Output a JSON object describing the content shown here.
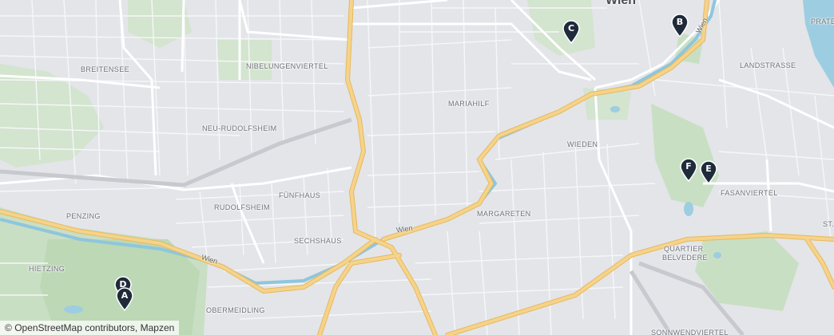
{
  "map": {
    "labels": {
      "wien_city": "Wien",
      "breitensee": "BREITENSEE",
      "nibelungenviertel": "NIBELUNGENVIERTEL",
      "mariahilf": "MARIAHILF",
      "landstrasse": "LANDSTRASSE",
      "praterc": "PRATERC",
      "neu_rudolfsheim": "NEU-RUDOLFSHEIM",
      "wieden": "WIEDEN",
      "fasanviertel": "FASANVIERTEL",
      "fuenfhaus": "FÜNFHAUS",
      "rudolfsheim": "RUDOLFSHEIM",
      "penzing": "PENZING",
      "margareten": "MARGARETEN",
      "sechshaus": "SECHSHAUS",
      "st": "ST.",
      "quartier_belvedere_1": "QUARTIER",
      "quartier_belvedere_2": "BELVEDERE",
      "hietzing": "HIETZING",
      "obermeidling": "OBERMEIDLING",
      "sonnwendviertel": "SONNWENDVIERTEL"
    },
    "road_labels": {
      "wien_river_1": "Wien",
      "wien_river_2": "Wien",
      "wien_river_3": "Wien"
    },
    "markers": [
      {
        "letter": "A"
      },
      {
        "letter": "B"
      },
      {
        "letter": "C"
      },
      {
        "letter": "D"
      },
      {
        "letter": "E"
      },
      {
        "letter": "F"
      }
    ],
    "marker_color": "#1f2a3a",
    "colors": {
      "background": "#e3e5e9",
      "park": "#c9dfc4",
      "major_road": "#f5d38b",
      "river": "#8ec6dc"
    },
    "attribution": {
      "copyright": "©",
      "text": "OpenStreetMap contributors, Mapzen"
    }
  }
}
